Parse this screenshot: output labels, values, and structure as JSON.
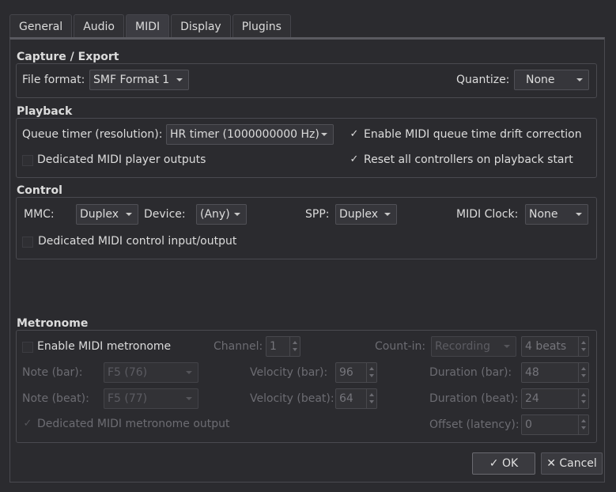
{
  "tabs": [
    {
      "label": "General"
    },
    {
      "label": "Audio"
    },
    {
      "label": "MIDI"
    },
    {
      "label": "Display"
    },
    {
      "label": "Plugins"
    }
  ],
  "active_tab": "MIDI",
  "capture": {
    "title": "Capture / Export",
    "file_format_label": "File format:",
    "file_format_value": "SMF Format 1",
    "quantize_label": "Quantize:",
    "quantize_value": "None"
  },
  "playback": {
    "title": "Playback",
    "queue_timer_label": "Queue timer (resolution):",
    "queue_timer_value": "HR timer (1000000000 Hz)",
    "drift_label": "Enable MIDI queue time drift correction",
    "drift_checked": "✓",
    "player_outputs_label": "Dedicated MIDI player outputs",
    "reset_label": "Reset all controllers on playback start",
    "reset_checked": "✓"
  },
  "control": {
    "title": "Control",
    "mmc_label": "MMC:",
    "mmc_value": "Duplex",
    "device_label": "Device:",
    "device_value": "(Any)",
    "spp_label": "SPP:",
    "spp_value": "Duplex",
    "clock_label": "MIDI Clock:",
    "clock_value": "None",
    "dedicated_label": "Dedicated MIDI control input/output"
  },
  "metronome": {
    "title": "Metronome",
    "enable_label": "Enable MIDI metronome",
    "channel_label": "Channel:",
    "channel_value": "1",
    "countin_label": "Count-in:",
    "countin_mode": "Recording",
    "countin_value": "4 beats",
    "note_bar_label": "Note (bar):",
    "note_bar_value": "F5 (76)",
    "velocity_bar_label": "Velocity (bar):",
    "velocity_bar_value": "96",
    "duration_bar_label": "Duration (bar):",
    "duration_bar_value": "48",
    "note_beat_label": "Note (beat):",
    "note_beat_value": "F5 (77)",
    "velocity_beat_label": "Velocity (beat):",
    "velocity_beat_value": "64",
    "duration_beat_label": "Duration (beat):",
    "duration_beat_value": "24",
    "dedicated_label": "Dedicated MIDI metronome output",
    "dedicated_checked": "✓",
    "offset_label": "Offset (latency):",
    "offset_value": "0"
  },
  "buttons": {
    "ok_icon": "✓",
    "ok_label": "OK",
    "cancel_icon": "✕",
    "cancel_label": "Cancel"
  },
  "colors": {
    "background": "#2b2b2f",
    "text": "#dcdcdc",
    "disabled_text": "#6c6c72"
  }
}
